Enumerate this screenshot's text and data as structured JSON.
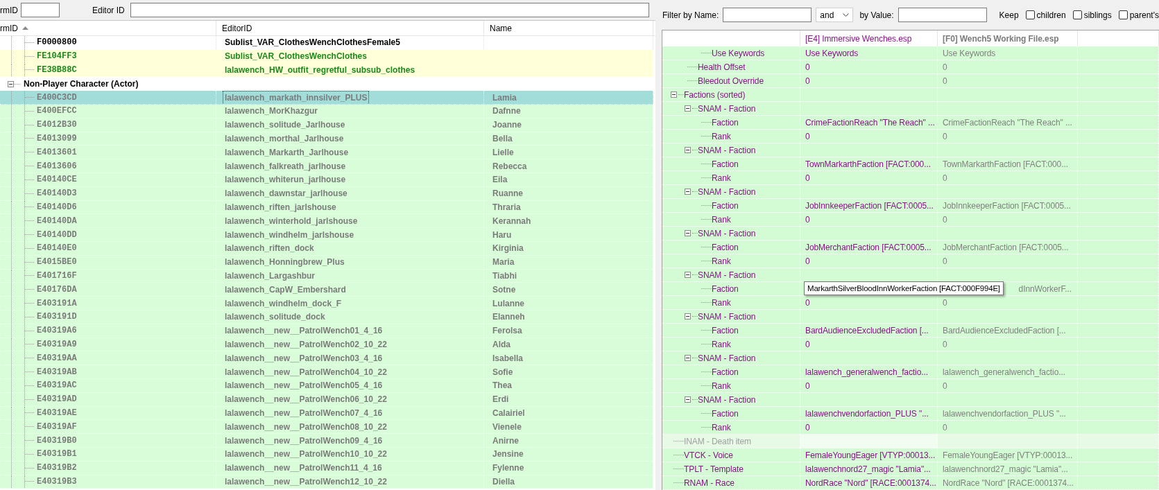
{
  "record_filter": {
    "fields": [
      {
        "label": "rmID"
      },
      {
        "label": "Editor ID"
      }
    ]
  },
  "record_list": {
    "columns": [
      {
        "label": "rmID",
        "sorted": true
      },
      {
        "label": "EditorID"
      },
      {
        "label": "Name"
      }
    ],
    "rows": [
      {
        "kind": "plain",
        "form_id": "F0000800",
        "editor_id": "Sublist_VAR_ClothesWenchClothesFemale5",
        "selected": false
      },
      {
        "kind": "override",
        "form_id": "FE104FF3",
        "editor_id": "Sublist_VAR_ClothesWenchClothes",
        "selected": false
      },
      {
        "kind": "override",
        "form_id": "FE38B88C",
        "editor_id": "lalawench_HW_outfit_regretful_subsub_clothes",
        "selected": false
      },
      {
        "kind": "group",
        "label": "Non-Player Character (Actor)",
        "expanded": true,
        "children": [
          {
            "kind": "match",
            "form_id": "E400C3CD",
            "editor_id": "lalawench_markath_innsilver_PLUS",
            "name": "Lamia",
            "selected": true
          },
          {
            "kind": "match",
            "form_id": "E400EFCC",
            "editor_id": "lalawench_MorKhazgur",
            "name": "Dafnne",
            "selected": false
          },
          {
            "kind": "match",
            "form_id": "E4012B30",
            "editor_id": "lalawench_solitude_Jarlhouse",
            "name": "Joanne",
            "selected": false
          },
          {
            "kind": "match",
            "form_id": "E4013099",
            "editor_id": "lalawench_morthal_Jarlhouse",
            "name": "Bella",
            "selected": false
          },
          {
            "kind": "match",
            "form_id": "E4013601",
            "editor_id": "lalawench_Markarth_Jarlhouse",
            "name": "Lielle",
            "selected": false
          },
          {
            "kind": "match",
            "form_id": "E4013606",
            "editor_id": "lalawench_falkreath_jarlhouse",
            "name": "Rebecca",
            "selected": false
          },
          {
            "kind": "match",
            "form_id": "E40140CE",
            "editor_id": "lalawench_whiterun_jarlhouse",
            "name": "Eila",
            "selected": false
          },
          {
            "kind": "match",
            "form_id": "E40140D3",
            "editor_id": "lalawench_dawnstar_jarlhouse",
            "name": "Ruanne",
            "selected": false
          },
          {
            "kind": "match",
            "form_id": "E40140D6",
            "editor_id": "lalawench_riften_jarlshouse",
            "name": "Thraria",
            "selected": false
          },
          {
            "kind": "match",
            "form_id": "E40140DA",
            "editor_id": "lalawench_winterhold_jarlshouse",
            "name": "Kerannah",
            "selected": false
          },
          {
            "kind": "match",
            "form_id": "E40140DD",
            "editor_id": "lalawench_windhelm_jarlshouse",
            "name": "Haru",
            "selected": false
          },
          {
            "kind": "match",
            "form_id": "E40140E0",
            "editor_id": "lalawench_riften_dock",
            "name": "Kirginia",
            "selected": false
          },
          {
            "kind": "match",
            "form_id": "E4015BE0",
            "editor_id": "lalawench_Honningbrew_Plus",
            "name": "Maria",
            "selected": false
          },
          {
            "kind": "match",
            "form_id": "E401716F",
            "editor_id": "lalawench_Largashbur",
            "name": "Tiabhi",
            "selected": false
          },
          {
            "kind": "match",
            "form_id": "E40176DA",
            "editor_id": "lalawench_CapW_Embershard",
            "name": "Sotne",
            "selected": false
          },
          {
            "kind": "match",
            "form_id": "E403191A",
            "editor_id": "lalawench_windhelm_dock_F",
            "name": "Lulanne",
            "selected": false
          },
          {
            "kind": "match",
            "form_id": "E403191D",
            "editor_id": "lalawench_solitude_dock",
            "name": "Elanneh",
            "selected": false
          },
          {
            "kind": "match",
            "form_id": "E40319A6",
            "editor_id": "lalawench__new__PatrolWench01_4_16",
            "name": "Ferolsa",
            "selected": false
          },
          {
            "kind": "match",
            "form_id": "E40319A9",
            "editor_id": "lalawench__new__PatrolWench02_10_22",
            "name": "Alda",
            "selected": false
          },
          {
            "kind": "match",
            "form_id": "E40319AA",
            "editor_id": "lalawench__new__PatrolWench03_4_16",
            "name": "Isabella",
            "selected": false
          },
          {
            "kind": "match",
            "form_id": "E40319AB",
            "editor_id": "lalawench__new__PatrolWench04_10_22",
            "name": "Sofie",
            "selected": false
          },
          {
            "kind": "match",
            "form_id": "E40319AC",
            "editor_id": "lalawench__new__PatrolWench05_4_16",
            "name": "Thea",
            "selected": false
          },
          {
            "kind": "match",
            "form_id": "E40319AD",
            "editor_id": "lalawench__new__PatrolWench06_10_22",
            "name": "Erdi",
            "selected": false
          },
          {
            "kind": "match",
            "form_id": "E40319AE",
            "editor_id": "lalawench__new__PatrolWench07_4_16",
            "name": "Calairiel",
            "selected": false
          },
          {
            "kind": "match",
            "form_id": "E40319AF",
            "editor_id": "lalawench__new__PatrolWench08_10_22",
            "name": "Vienele",
            "selected": false
          },
          {
            "kind": "match",
            "form_id": "E40319B0",
            "editor_id": "lalawench__new__PatrolWench09_4_16",
            "name": "Anirne",
            "selected": false
          },
          {
            "kind": "match",
            "form_id": "E40319B1",
            "editor_id": "lalawench__new__PatrolWench10_10_22",
            "name": "Jensine",
            "selected": false
          },
          {
            "kind": "match",
            "form_id": "E40319B2",
            "editor_id": "lalawench__new__PatrolWench11_4_16",
            "name": "Fylenne",
            "selected": false
          },
          {
            "kind": "match",
            "form_id": "E40319B3",
            "editor_id": "lalawench__new__PatrolWench12_10_22",
            "name": "Diella",
            "selected": false
          }
        ]
      }
    ]
  },
  "record_view": {
    "filter": {
      "name_label": "Filter by Name:",
      "operator": "and",
      "value_label": "by Value:",
      "keep_label": "Keep",
      "keep": [
        {
          "label": "children",
          "checked": false
        },
        {
          "label": "siblings",
          "checked": false
        },
        {
          "label": "parent's",
          "checked": false
        }
      ]
    },
    "columns": [
      {
        "label": "[E4] Immersive Wenches.esp",
        "highlight": true
      },
      {
        "label": "[F0] Wench5 Working File.esp",
        "highlight": false
      }
    ],
    "rows": [
      {
        "kind": "continued",
        "children": [
          {
            "kind": "continued",
            "children": [
              {
                "kind": "field",
                "label": "Use Keywords",
                "value_1": "Use Keywords",
                "value_2": "Use Keywords"
              }
            ]
          },
          {
            "kind": "field",
            "label": "Health Offset",
            "value_1": "0",
            "value_2": "0"
          },
          {
            "kind": "field",
            "label": "Bleedout Override",
            "value_1": "0",
            "value_2": "0"
          }
        ]
      },
      {
        "kind": "field",
        "label": "Factions (sorted)",
        "expanded": true,
        "children": [
          {
            "kind": "field",
            "label": "SNAM - Faction",
            "expanded": true,
            "children": [
              {
                "kind": "field",
                "label": "Faction",
                "value_1": "CrimeFactionReach \"The Reach\" ...",
                "value_2": "CrimeFactionReach \"The Reach\" ..."
              },
              {
                "kind": "field",
                "label": "Rank",
                "value_1": "0",
                "value_2": "0"
              }
            ]
          },
          {
            "kind": "field",
            "label": "SNAM - Faction",
            "expanded": true,
            "children": [
              {
                "kind": "field",
                "label": "Faction",
                "value_1": "TownMarkarthFaction [FACT:000...",
                "value_2": "TownMarkarthFaction [FACT:000..."
              },
              {
                "kind": "field",
                "label": "Rank",
                "value_1": "0",
                "value_2": "0"
              }
            ]
          },
          {
            "kind": "field",
            "label": "SNAM - Faction",
            "expanded": true,
            "children": [
              {
                "kind": "field",
                "label": "Faction",
                "value_1": "JobInnkeeperFaction [FACT:0005...",
                "value_2": "JobInnkeeperFaction [FACT:0005..."
              },
              {
                "kind": "field",
                "label": "Rank",
                "value_1": "0",
                "value_2": "0"
              }
            ]
          },
          {
            "kind": "field",
            "label": "SNAM - Faction",
            "expanded": true,
            "children": [
              {
                "kind": "field",
                "label": "Faction",
                "value_1": "JobMerchantFaction [FACT:0005...",
                "value_2": "JobMerchantFaction [FACT:0005..."
              },
              {
                "kind": "field",
                "label": "Rank",
                "value_1": "0",
                "value_2": "0"
              }
            ]
          },
          {
            "kind": "field",
            "label": "SNAM - Faction",
            "expanded": true,
            "children": [
              {
                "kind": "field",
                "label": "Faction",
                "value_2": "dInnWorkerF...",
                "tooltip": "MarkarthSilverBloodInnWorkerFaction [FACT:000F994E]"
              },
              {
                "kind": "field",
                "label": "Rank",
                "value_1": "0",
                "value_2": "0"
              }
            ]
          },
          {
            "kind": "field",
            "label": "SNAM - Faction",
            "expanded": true,
            "children": [
              {
                "kind": "field",
                "label": "Faction",
                "value_1": "BardAudienceExcludedFaction [...",
                "value_2": "BardAudienceExcludedFaction [..."
              },
              {
                "kind": "field",
                "label": "Rank",
                "value_1": "0",
                "value_2": "0"
              }
            ]
          },
          {
            "kind": "field",
            "label": "SNAM - Faction",
            "expanded": true,
            "children": [
              {
                "kind": "field",
                "label": "Faction",
                "value_1": "lalawench_generalwench_factio...",
                "value_2": "lalawench_generalwench_factio..."
              },
              {
                "kind": "field",
                "label": "Rank",
                "value_1": "0",
                "value_2": "0"
              }
            ]
          },
          {
            "kind": "field",
            "label": "SNAM - Faction",
            "expanded": true,
            "children": [
              {
                "kind": "field",
                "label": "Faction",
                "value_1": "lalawenchvendorfaction_PLUS \"...",
                "value_2": "lalawenchvendorfaction_PLUS \"..."
              },
              {
                "kind": "field",
                "label": "Rank",
                "value_1": "0",
                "value_2": "0"
              }
            ]
          }
        ]
      },
      {
        "kind": "field",
        "label": "INAM - Death item",
        "disabled": true
      },
      {
        "kind": "field",
        "label": "VTCK - Voice",
        "value_1": "FemaleYoungEager [VTYP:00013...",
        "value_2": "FemaleYoungEager [VTYP:00013..."
      },
      {
        "kind": "field",
        "label": "TPLT - Template",
        "value_1": "lalawenchnord27_magic \"Lamia\"...",
        "value_2": "lalawenchnord27_magic \"Lamia\"..."
      },
      {
        "kind": "field",
        "label": "RNAM - Race",
        "value_1": "NordRace \"Nord\" [RACE:0001374...",
        "value_2": "NordRace \"Nord\" [RACE:0001374..."
      }
    ]
  }
}
